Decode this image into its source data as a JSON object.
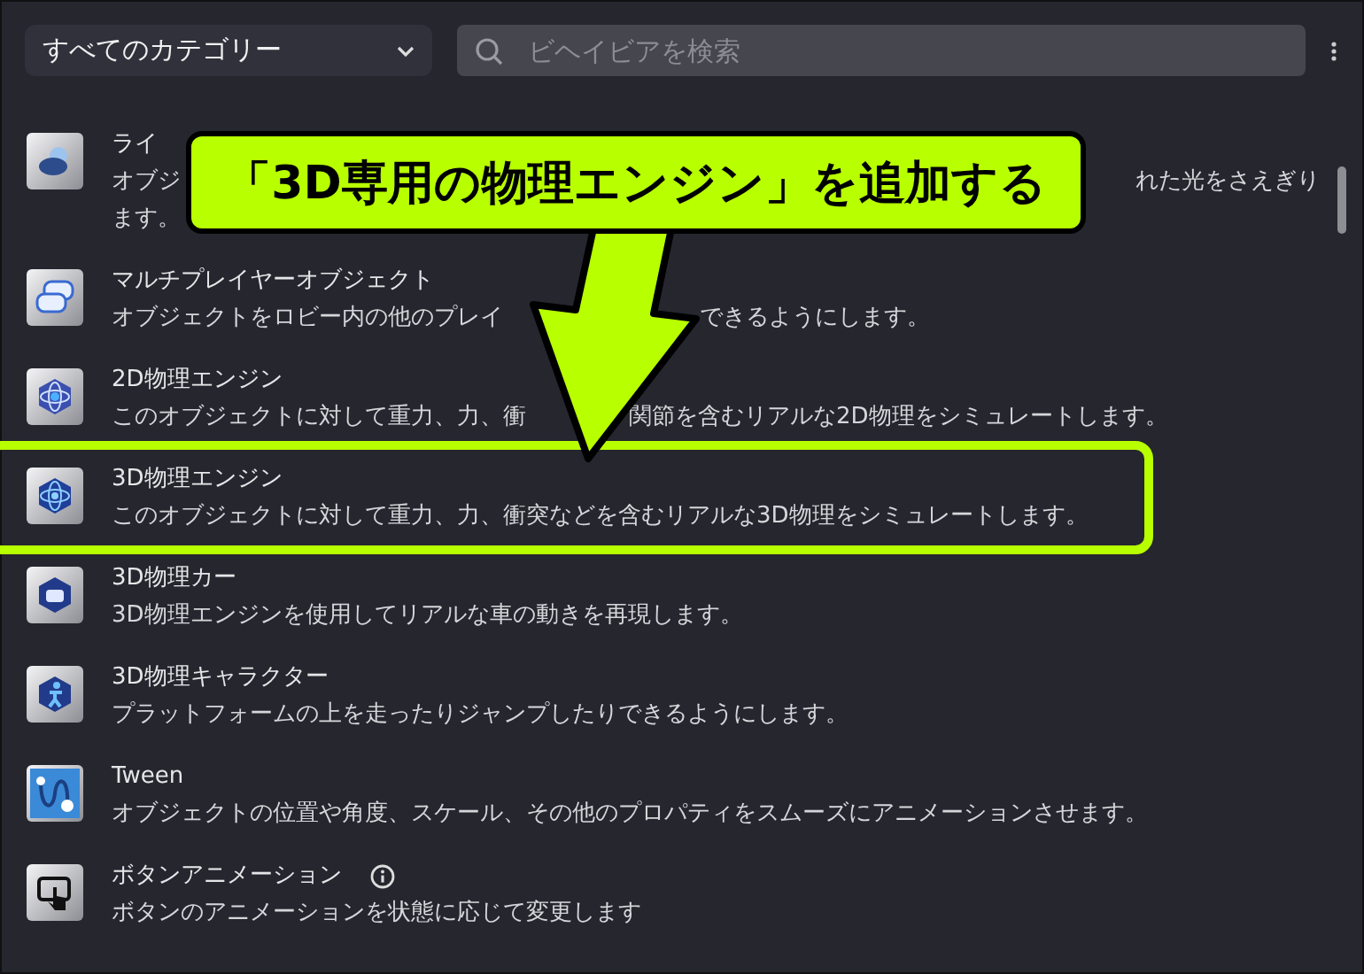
{
  "toolbar": {
    "category_dropdown": "すべてのカテゴリー",
    "search": {
      "placeholder": "ビヘイビアを検索"
    }
  },
  "behaviors": [
    {
      "title": "ライ",
      "info": false,
      "highlighted": false,
      "description_lines": [
        [
          "オブジ",
          "れた光をさえぎり"
        ],
        [
          "ます。"
        ]
      ]
    },
    {
      "title": "マルチプレイヤーオブジェクト",
      "info": false,
      "highlighted": false,
      "description_lines": [
        [
          "オブジェクトをロビー内の他のプレイ",
          "できるようにします。"
        ]
      ]
    },
    {
      "title": "2D物理エンジン",
      "info": false,
      "highlighted": false,
      "description_lines": [
        [
          "このオブジェクトに対して重力、力、衝",
          "関節を含むリアルな2D物理をシミュレートします。"
        ]
      ]
    },
    {
      "title": "3D物理エンジン",
      "info": false,
      "highlighted": true,
      "description_lines": [
        [
          "このオブジェクトに対して重力、力、衝突などを含むリアルな3D物理をシミュレートします。"
        ]
      ]
    },
    {
      "title": "3D物理カー",
      "info": false,
      "highlighted": false,
      "description_lines": [
        [
          "3D物理エンジンを使用してリアルな車の動きを再現します。"
        ]
      ]
    },
    {
      "title": "3D物理キャラクター",
      "info": false,
      "highlighted": false,
      "description_lines": [
        [
          "プラットフォームの上を走ったりジャンプしたりできるようにします。"
        ]
      ]
    },
    {
      "title": "Tween",
      "info": false,
      "highlighted": false,
      "description_lines": [
        [
          "オブジェクトの位置や角度、スケール、その他のプロパティをスムーズにアニメーションさせます。"
        ]
      ]
    },
    {
      "title": "ボタンアニメーション",
      "info": true,
      "highlighted": false,
      "description_lines": [
        [
          "ボタンのアニメーションを状態に応じて変更します"
        ]
      ]
    }
  ],
  "annotation": {
    "callout": "「3D専用の物理エンジン」を追加する"
  }
}
